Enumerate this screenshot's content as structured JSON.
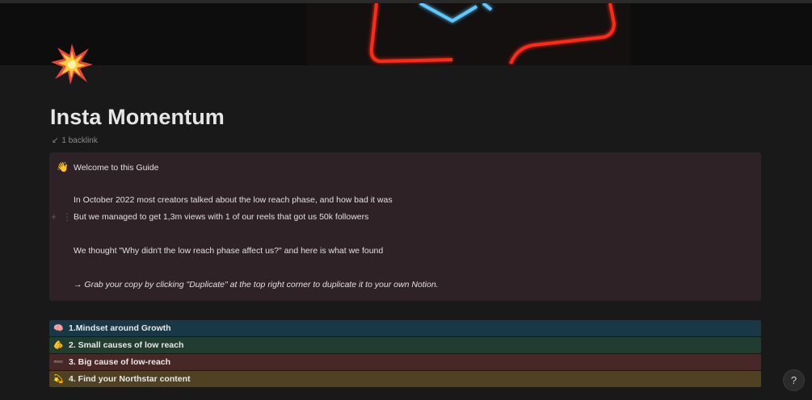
{
  "page": {
    "icon": "collision-icon",
    "title": "Insta Momentum",
    "backlink": "1 backlink"
  },
  "colors": {
    "background": "#191919",
    "callout_bg": "#2f2226",
    "toggle_blue": "#183847",
    "toggle_green": "#203d2f",
    "toggle_red": "#482826",
    "toggle_yellow": "#4f4121"
  },
  "callout": {
    "emoji": "👋",
    "lines": [
      "Welcome to this Guide",
      "In October 2022 most creators talked about the low reach phase, and how bad it was",
      "But we managed to get 1,3m views with 1 of our reels that got us 50k followers",
      "We thought \"Why didn't the low reach phase affect us?\" and here is what we found",
      "→ Grab your copy by clicking \"Duplicate\" at the top right corner to duplicate it to your own Notion."
    ]
  },
  "toggles": [
    {
      "emoji": "🧠",
      "label": "1.Mindset around Growth"
    },
    {
      "emoji": "🫵",
      "label": "2. Small causes of low reach"
    },
    {
      "emoji": "➖",
      "label": "3. Big cause of low-reach"
    },
    {
      "emoji": "💫",
      "label": "4. Find your Northstar content"
    }
  ],
  "help": "?"
}
